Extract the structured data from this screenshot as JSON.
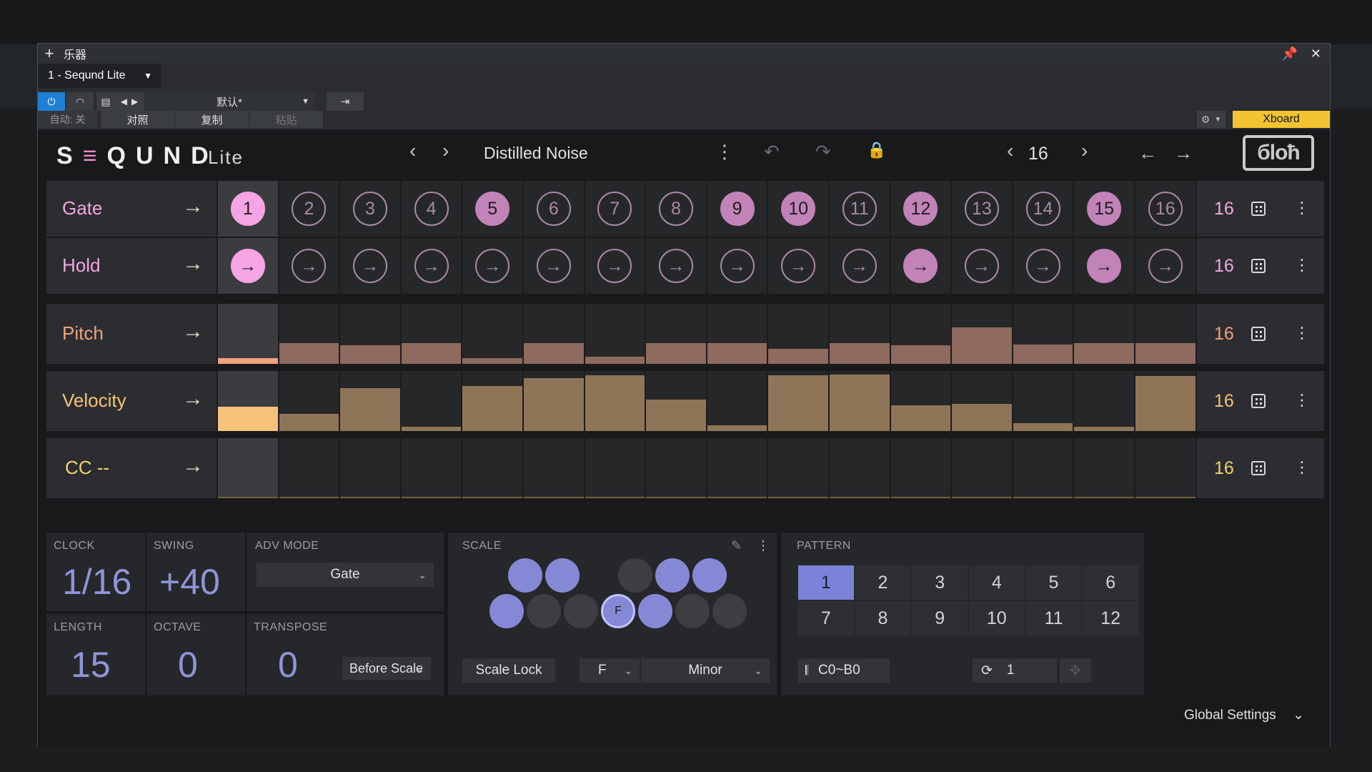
{
  "host": {
    "window_title": "乐器",
    "track_name": "1 - Seqund Lite",
    "preset_select": "默认*",
    "auto_label": "自动: 关",
    "compare_label": "对照",
    "copy_label": "复制",
    "paste_label": "粘贴",
    "xboard_label": "Xboard"
  },
  "plugin": {
    "logo": "SEQUND",
    "logo_suffix": "Lite",
    "preset_name": "Distilled Noise",
    "steps": "16",
    "brand": "бloħ",
    "accent_colors": {
      "gate": "#f6a4e4",
      "pitch": "#f0a17e",
      "velocity": "#f6c27a",
      "cc": "#f3d36e",
      "scale": "#8589d5"
    }
  },
  "lanes": [
    {
      "name": "Gate",
      "count": "16",
      "labels": [
        "1",
        "2",
        "3",
        "4",
        "5",
        "6",
        "7",
        "8",
        "9",
        "10",
        "11",
        "12",
        "13",
        "14",
        "15",
        "16"
      ],
      "on": [
        true,
        false,
        false,
        false,
        true,
        false,
        false,
        false,
        true,
        true,
        false,
        true,
        false,
        false,
        true,
        false
      ]
    },
    {
      "name": "Hold",
      "count": "16",
      "on": [
        true,
        false,
        false,
        false,
        false,
        false,
        false,
        false,
        false,
        false,
        false,
        true,
        false,
        false,
        true,
        false
      ]
    },
    {
      "name": "Pitch",
      "count": "16",
      "values": [
        0.1,
        0.36,
        0.32,
        0.36,
        0.1,
        0.36,
        0.12,
        0.36,
        0.36,
        0.26,
        0.36,
        0.33,
        0.64,
        0.34,
        0.36,
        0.36
      ]
    },
    {
      "name": "Velocity",
      "count": "16",
      "values": [
        0.42,
        0.3,
        0.75,
        0.07,
        0.79,
        0.93,
        0.98,
        0.55,
        0.1,
        0.98,
        0.99,
        0.45,
        0.47,
        0.14,
        0.08,
        0.96
      ]
    },
    {
      "name": "CC --",
      "count": "16",
      "values": [
        0.02,
        0.02,
        0.02,
        0.02,
        0.02,
        0.02,
        0.02,
        0.02,
        0.02,
        0.02,
        0.02,
        0.02,
        0.02,
        0.02,
        0.02,
        0.02
      ]
    }
  ],
  "controls": {
    "clock": {
      "label": "CLOCK",
      "value": "1/16"
    },
    "swing": {
      "label": "SWING",
      "value": "+40"
    },
    "adv_mode": {
      "label": "ADV MODE",
      "value": "Gate"
    },
    "length": {
      "label": "LENGTH",
      "value": "15"
    },
    "octave": {
      "label": "OCTAVE",
      "value": "0"
    },
    "transpose": {
      "label": "TRANSPOSE",
      "value": "0",
      "mode": "Before Scale"
    }
  },
  "scale": {
    "label": "SCALE",
    "root_label": "F",
    "lock_label": "Scale Lock",
    "key": "F",
    "type": "Minor",
    "top_on": [
      true,
      true,
      false,
      true,
      true
    ],
    "bottom_on": [
      true,
      false,
      false,
      true,
      true,
      false,
      false
    ]
  },
  "pattern": {
    "label": "PATTERN",
    "cells": [
      "1",
      "2",
      "3",
      "4",
      "5",
      "6",
      "7",
      "8",
      "9",
      "10",
      "11",
      "12"
    ],
    "selected": 0,
    "range": "C0~B0",
    "repeat": "1"
  },
  "footer": {
    "global_settings": "Global Settings"
  }
}
